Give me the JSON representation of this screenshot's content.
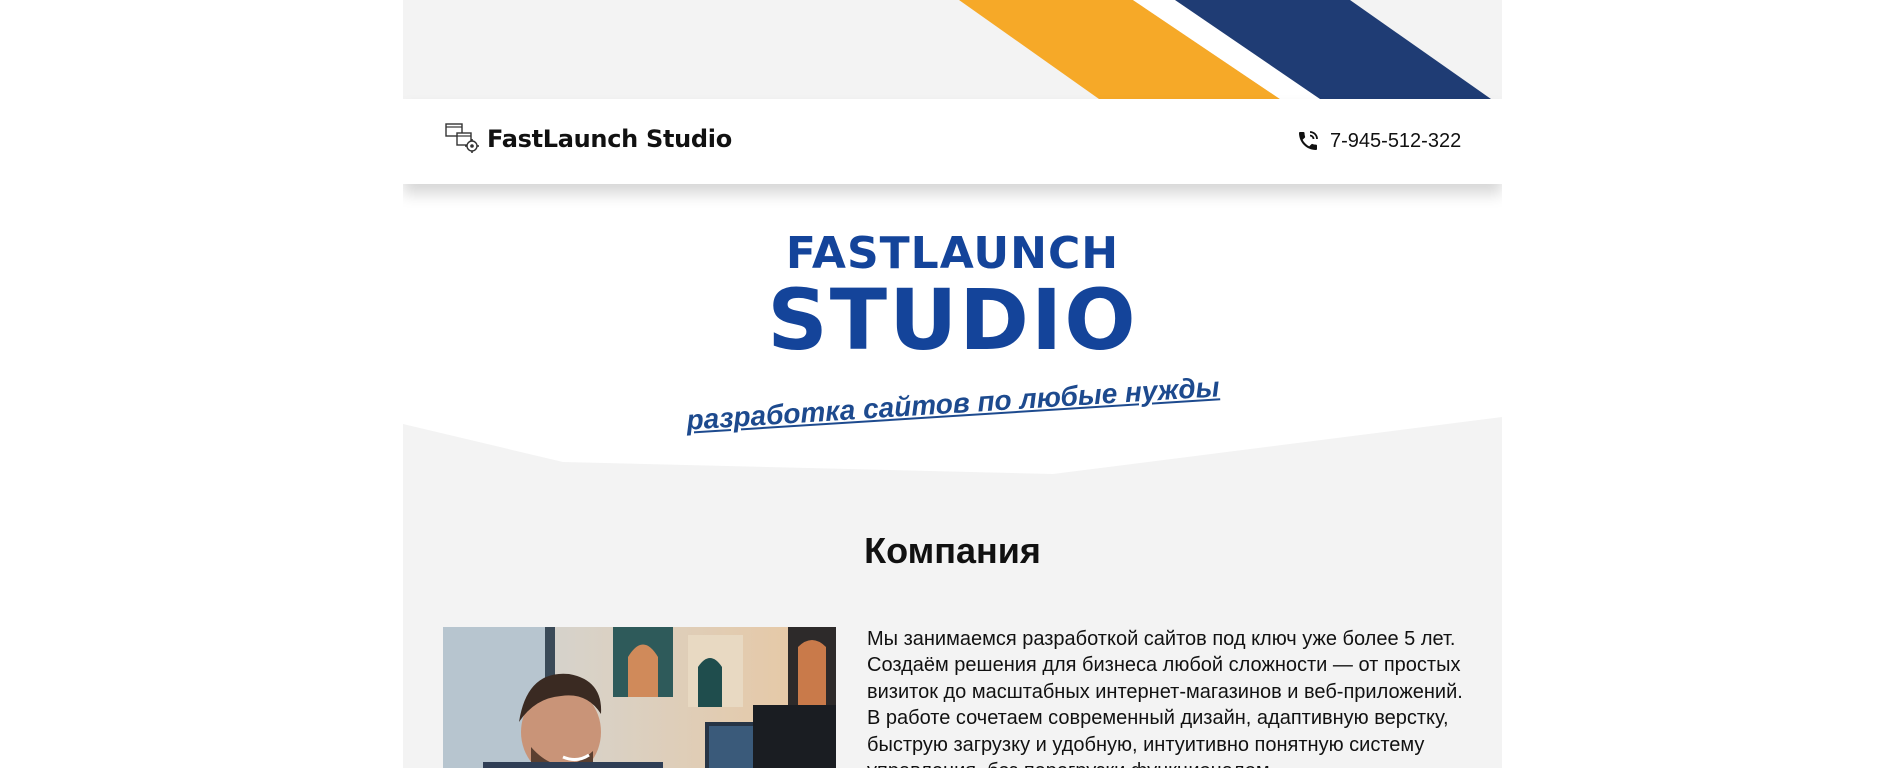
{
  "header": {
    "brand": "FastLaunch Studio",
    "phone": "7-945-512-322",
    "logo_icon": "window-gear-icon",
    "phone_icon": "phone-ringing-icon"
  },
  "hero": {
    "logo_line1": "FASTLAUNCH",
    "logo_line2": "STUDIO",
    "tagline": "разработка сайтов по любые нужды"
  },
  "company": {
    "title": "Компания",
    "text": "Мы занимаемся разработкой сайтов под ключ уже более 5 лет. Создаём решения для бизнеса любой сложности — от простых визиток до масштабных интернет-магазинов и веб-приложений. В работе сочетаем современный дизайн, адаптивную верстку, быструю загрузку и удобную, интуитивно понятную систему управления, без перегрузки функционалом."
  },
  "colors": {
    "accent_orange": "#f6a928",
    "accent_navy": "#1f3c74",
    "logo_blue": "#14449a",
    "background": "#f3f3f3"
  }
}
